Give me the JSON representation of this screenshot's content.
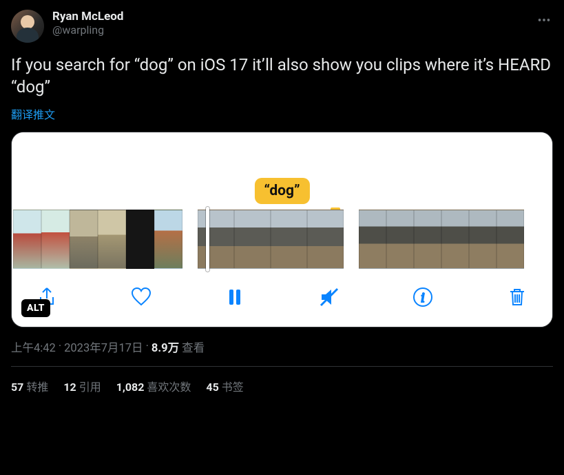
{
  "author": {
    "display_name": "Ryan McLeod",
    "handle": "@warpling"
  },
  "content": {
    "text": "If you search for “dog” on iOS 17 it’ll also show you clips where it’s HEARD “dog”",
    "translate_label": "翻译推文"
  },
  "media": {
    "badge_text": "“dog”",
    "alt_label": "ALT",
    "toolbar_icons": {
      "share": "share-icon",
      "like": "heart-icon",
      "pause": "pause-icon",
      "mute": "mute-icon",
      "info": "info-icon",
      "trash": "trash-icon"
    }
  },
  "meta": {
    "time": "上午4:42",
    "sep": " · ",
    "date": "2023年7月17日",
    "views_num": "8.9万",
    "views_label": " 查看"
  },
  "stats": {
    "retweets_num": "57",
    "retweets_label": "转推",
    "quotes_num": "12",
    "quotes_label": "引用",
    "likes_num": "1,082",
    "likes_label": "喜欢次数",
    "bookmarks_num": "45",
    "bookmarks_label": "书签"
  }
}
